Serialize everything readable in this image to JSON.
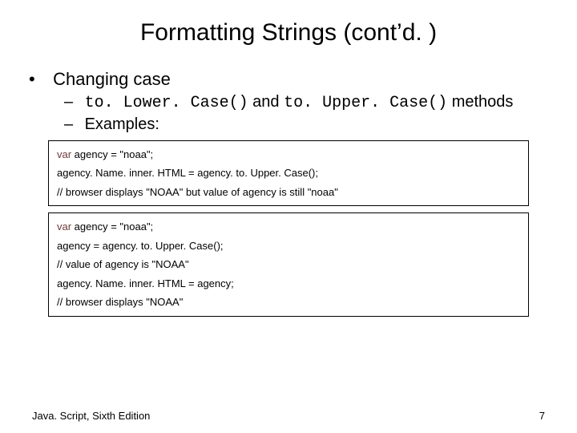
{
  "title": "Formatting Strings (cont’d. )",
  "bullets": {
    "level1_item": "Changing case",
    "level2_item1_pre": "to. Lower. Case()",
    "level2_item1_mid": " and ",
    "level2_item1_post": "to. Upper. Case()",
    "level2_item1_tail": " methods",
    "level2_item2": "Examples:"
  },
  "codebox1": {
    "l1a": "var",
    "l1b": " agency = \"noaa\";",
    "l2": "agency. Name. inner. HTML = agency. to. Upper. Case();",
    "l3": "// browser displays \"NOAA\" but value of agency is still \"noaa\""
  },
  "codebox2": {
    "l1a": "var",
    "l1b": " agency = \"noaa\";",
    "l2": "agency = agency. to. Upper. Case();",
    "l3": "// value of agency is \"NOAA\"",
    "l4": "agency. Name. inner. HTML = agency;",
    "l5": "// browser displays \"NOAA\""
  },
  "footer": {
    "left": "Java. Script, Sixth Edition",
    "right": "7"
  }
}
